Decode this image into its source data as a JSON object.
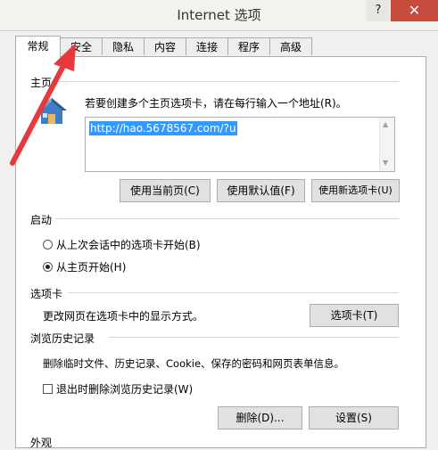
{
  "window": {
    "title": "Internet 选项",
    "help_label": "?",
    "close_label": "✕"
  },
  "tabs": [
    {
      "label": "常规",
      "active": true
    },
    {
      "label": "安全",
      "active": false
    },
    {
      "label": "隐私",
      "active": false
    },
    {
      "label": "内容",
      "active": false
    },
    {
      "label": "连接",
      "active": false
    },
    {
      "label": "程序",
      "active": false
    },
    {
      "label": "高级",
      "active": false
    }
  ],
  "homepage": {
    "section_title": "主页",
    "instruction": "若要创建多个主页选项卡，请在每行输入一个地址(R)。",
    "url": "http://hao.5678567.com/?u",
    "buttons": {
      "use_current": "使用当前页(C)",
      "use_default": "使用默认值(F)",
      "use_new_tab": "使用新选项卡(U)"
    }
  },
  "startup": {
    "section_title": "启动",
    "options": [
      {
        "label": "从上次会话中的选项卡开始(B)",
        "selected": false
      },
      {
        "label": "从主页开始(H)",
        "selected": true
      }
    ]
  },
  "tabs_section": {
    "section_title": "选项卡",
    "description": "更改网页在选项卡中的显示方式。",
    "button": "选项卡(T)"
  },
  "history": {
    "section_title": "浏览历史记录",
    "description": "删除临时文件、历史记录、Cookie、保存的密码和网页表单信息。",
    "delete_on_exit_label": "退出时删除浏览历史记录(W)",
    "delete_on_exit_checked": false,
    "delete_button": "删除(D)...",
    "settings_button": "设置(S)"
  },
  "appearance": {
    "section_title": "外观"
  },
  "colors": {
    "annotation_arrow": "#e5393b",
    "selection": "#3399ff",
    "close_button": "#c74b3c"
  }
}
